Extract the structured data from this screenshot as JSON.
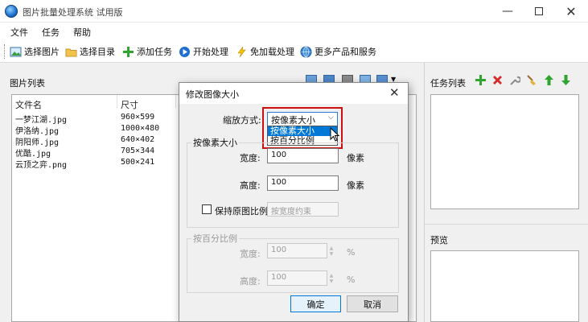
{
  "window": {
    "title": "图片批量处理系统 试用版"
  },
  "menu": {
    "items": [
      "文件",
      "任务",
      "帮助"
    ]
  },
  "toolbar": {
    "select_images": "选择图片",
    "select_folder": "选择目录",
    "add_task": "添加任务",
    "start": "开始处理",
    "free_download": "免加载处理",
    "more": "更多产品和服务"
  },
  "file_list": {
    "title": "图片列表",
    "col_name": "文件名",
    "col_size": "尺寸",
    "rows": [
      {
        "name": "一梦江湖.jpg",
        "size": "960×599"
      },
      {
        "name": "伊洛纳.jpg",
        "size": "1000×480"
      },
      {
        "name": "阴阳师.jpg",
        "size": "640×402"
      },
      {
        "name": "优酷.jpg",
        "size": "705×344"
      },
      {
        "name": "云顶之弈.png",
        "size": "500×241"
      }
    ]
  },
  "tasks": {
    "title": "任务列表"
  },
  "preview": {
    "title": "预览"
  },
  "dialog": {
    "title": "修改图像大小",
    "scale_label": "缩放方式:",
    "scale_value": "按像素大小",
    "scale_options": [
      "按像素大小",
      "按百分比例"
    ],
    "pixel_group": "按像素大小",
    "width_label": "宽度:",
    "width_value": "100",
    "height_label": "高度:",
    "height_value": "100",
    "unit_px": "像素",
    "keep_ratio": "保持原图比例",
    "ratio_select": "按宽度约束",
    "percent_group": "按百分比例",
    "pwidth_label": "宽度:",
    "pwidth_value": "100",
    "pheight_label": "高度:",
    "pheight_value": "100",
    "unit_pct": "%",
    "ok": "确定",
    "cancel": "取消"
  },
  "colors": {
    "accent": "#0078d7",
    "highlight": "#d01010",
    "selected_bg": "#0078d7"
  }
}
